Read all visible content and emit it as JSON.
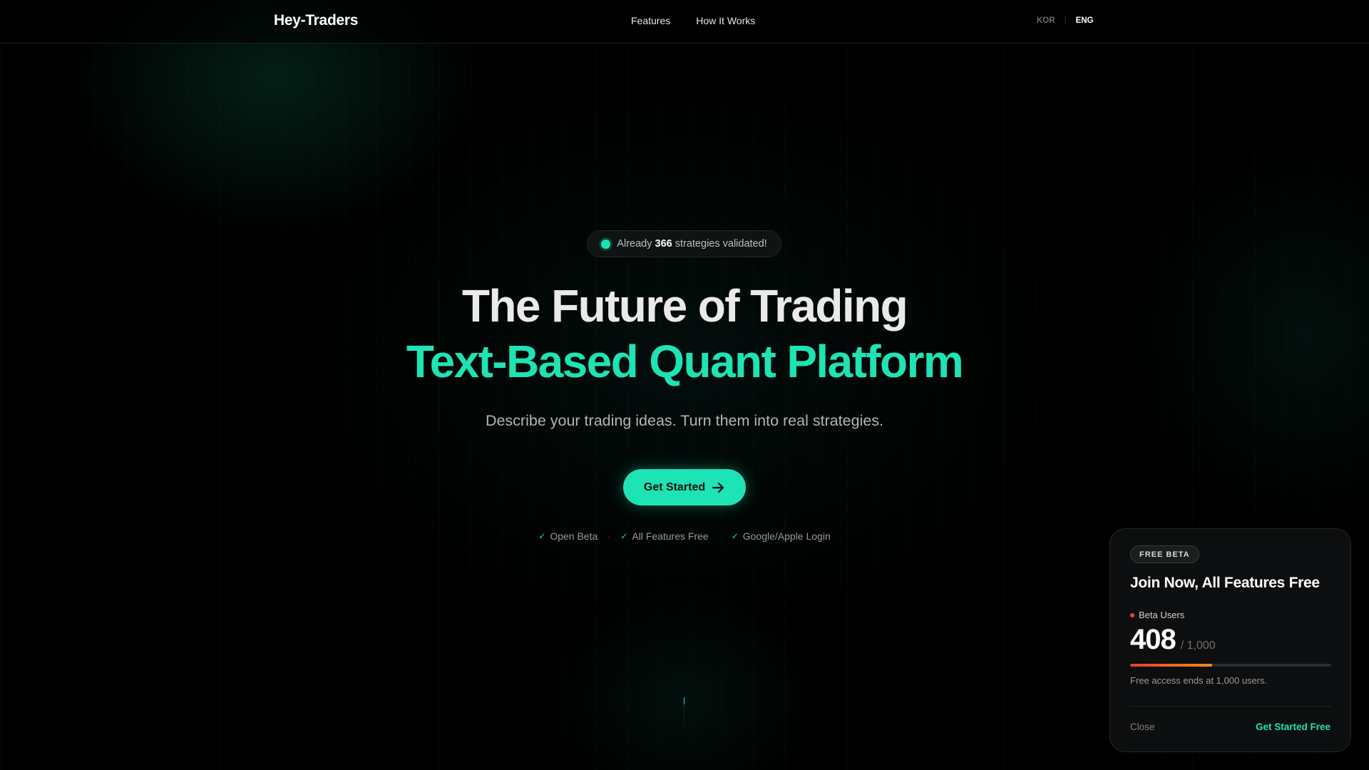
{
  "nav": {
    "logo": "Hey-Traders",
    "links": [
      "Features",
      "How It Works"
    ],
    "lang": {
      "kor": "KOR",
      "separator": "|",
      "eng": "ENG",
      "active": "ENG"
    }
  },
  "hero": {
    "pill": {
      "prefix": "Already",
      "count": "366",
      "suffix": "strategies validated!"
    },
    "title_line1": "The Future of Trading",
    "title_line2": "Text-Based Quant Platform",
    "subtitle": "Describe your trading ideas. Turn them into real strategies.",
    "cta_label": "Get Started",
    "checks": [
      "Open Beta",
      "All Features Free",
      "Google/Apple Login"
    ],
    "check_separator": "·"
  },
  "beta_card": {
    "badge": "FREE BETA",
    "title": "Join Now, All Features Free",
    "users_label": "Beta Users",
    "users_count": "408",
    "users_total": "/ 1,000",
    "progress_fraction": 0.408,
    "notice": "Free access ends at 1,000 users.",
    "close_label": "Close",
    "cta_label": "Get Started Free"
  },
  "colors": {
    "accent": "#1ee3b4",
    "progress_start": "#ef3b2c",
    "progress_end": "#f58a1f",
    "live_dot": "#ff3b3b"
  },
  "icons": {
    "cta": "arrow-right-icon",
    "check": "check-icon",
    "pill": "status-dot-icon"
  }
}
